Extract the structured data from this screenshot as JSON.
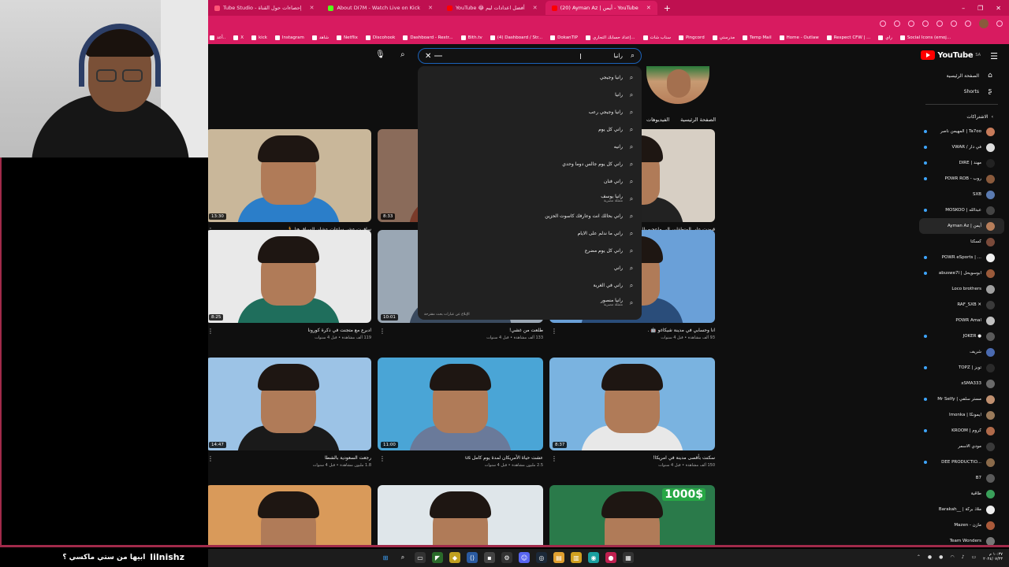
{
  "browser": {
    "tabs": [
      {
        "label": "Tube Studio - إحصاءات حول القناة",
        "color": "#ff5577"
      },
      {
        "label": "About DI7M - Watch Live on Kick",
        "color": "#53fc18"
      },
      {
        "label": "YouTube 😂 أفضل اعدادات ليم",
        "color": "#ff0000"
      },
      {
        "label": "(20) Ayman Az | أيمن - YouTube",
        "color": "#ff0000",
        "active": true
      }
    ],
    "new_tab": "+",
    "window_controls": [
      "–",
      "❐",
      "✕"
    ],
    "bookmarks": [
      "أعد..",
      "X",
      "kick",
      "Instagram",
      "شاهد",
      "Netflix",
      "Discohook",
      "Dashboard - Restr...",
      "Bith.tv",
      "(4) Dashboard / Str...",
      "DokanTIP",
      "إعداد حسابك التجاري...",
      "سناب شات",
      "Pingcord",
      "مدرستي",
      "Temp Mail",
      "Home - Outlaw",
      "Respect CFW | ...",
      "راي",
      "Social Icons (emoj..."
    ]
  },
  "youtube": {
    "logo": "YouTube",
    "logo_region": "SA",
    "search": {
      "query": "رانيا",
      "placeholder": "",
      "clear_label": "✕"
    },
    "suggestions": [
      {
        "text": "رانيا وجيجي"
      },
      {
        "text": "رانيا"
      },
      {
        "text": "رانيا وجيجي رعب"
      },
      {
        "text": "راني كل يوم"
      },
      {
        "text": "رانيه"
      },
      {
        "text": "راني كل يوم جالس دوما وحدي"
      },
      {
        "text": "راني فنان"
      },
      {
        "text": "رانيا يوسف",
        "sub": "ممثلة مصرية"
      },
      {
        "text": "راني بحالك انت وعارفك كاسوت الحزين"
      },
      {
        "text": "راني ما ندلم على الايام"
      },
      {
        "text": "راني كل يوم مضرع"
      },
      {
        "text": "راني"
      },
      {
        "text": "راني في الغربة"
      },
      {
        "text": "رانيا منصور",
        "sub": "ممثلة مصرية"
      }
    ],
    "report_link": "الإبلاغ عن عبارات بحث مقترحة",
    "channel_tabs": [
      "الصفحة الرئيسية",
      "الفيديوهات"
    ],
    "videos": [
      {
        "title": "سافرت عشر ساعات عشان السباق هنا 🏃",
        "stats": "112 ألف مشاهدة • قبل 4 سنوات",
        "duration": "13:30",
        "bg": "#c9b79a",
        "shirt": "#2b7ec9"
      },
      {
        "title": "",
        "stats": "",
        "duration": "8:33",
        "bg": "#8a6b5a",
        "shirt": "#7a3b2a"
      },
      {
        "title": "قبضت على المتطفلين الي ماعجبو بالد...",
        "stats": "239 ألف مشاهدة • قبل 5 سنوات",
        "duration": "",
        "bg": "#d7cfc4",
        "shirt": "#222222"
      },
      {
        "title": "ادبرع مع متجنت في ذكرة كورونا",
        "stats": "119 ألف مشاهدة • قبل 4 سنوات",
        "duration": "8:25",
        "bg": "#e9e9e9",
        "shirt": "#1f6e5c"
      },
      {
        "title": "طلعت من غشي!",
        "stats": "133 ألف مشاهدة • قبل 4 سنوات",
        "duration": "10:01",
        "bg": "#9aa7b4",
        "shirt": "#3a4a5e"
      },
      {
        "title": "انا وحسابي في مدينة شيكاغو 🤖 .",
        "stats": "93 ألف مشاهدة • قبل 4 سنوات",
        "duration": "",
        "bg": "#6aa0d8",
        "shirt": "#2a4d7a"
      },
      {
        "title": "رجعت السعودية بالشطا",
        "stats": "1.8 مليون مشاهدة • قبل 4 سنوات",
        "duration": "14:47",
        "bg": "#9cc3e6",
        "shirt": "#1a1a1a"
      },
      {
        "title": "عشت حياة الأمريكان لمدة يوم كامل us",
        "stats": "2.5 مليون مشاهدة • قبل 4 سنوات",
        "duration": "11:00",
        "bg": "#4aa5d6",
        "shirt": "#6a7a9a"
      },
      {
        "title": "سكنت بأقصى مدينة في امريكا!",
        "stats": "150 ألف مشاهدة • قبل 4 سنوات",
        "duration": "8:37",
        "bg": "#7ab3e0",
        "shirt": "#e8e8e8"
      },
      {
        "title": "",
        "stats": "",
        "duration": "",
        "bg": "#d99a5a",
        "shirt": "#3a3a6a"
      },
      {
        "title": "",
        "stats": "",
        "duration": "",
        "bg": "#dfe6ea",
        "shirt": "#7a7a7a"
      },
      {
        "title": "",
        "stats": "",
        "duration": "",
        "bg": "#2a7a4a",
        "shirt": "#2a2a2a",
        "badge": "1000$"
      }
    ],
    "sidebar": {
      "home": "الصفحة الرئيسية",
      "shorts": "Shorts",
      "subscriptions_heading": "الاشتراكات",
      "subs": [
        {
          "name": "المهيمن ناصر | Ta7oo",
          "color": "#c77b5a",
          "live": true
        },
        {
          "name": "VWAR / في دار",
          "color": "#dddddd",
          "live": true
        },
        {
          "name": "DIRE | مهند",
          "color": "#222222",
          "live": true
        },
        {
          "name": "POWR ROB - روب",
          "color": "#8a5a3c",
          "live": true
        },
        {
          "name": "SXB",
          "color": "#5a7ab0",
          "live": false
        },
        {
          "name": "MOSKOO | عبدالله",
          "color": "#444444",
          "live": true
        },
        {
          "name": "Ayman Az | أيمن",
          "color": "#b77e5a",
          "live": false,
          "active": true
        },
        {
          "name": "كسكتا",
          "color": "#7a4a3a",
          "live": false
        },
        {
          "name": "POWR eSports | ...",
          "color": "#f0f0f0",
          "live": true
        },
        {
          "name": "abuswe7l | ابوسويحل",
          "color": "#9a5a3a",
          "live": true
        },
        {
          "name": "Loco brothers",
          "color": "#a0a0a0",
          "live": false
        },
        {
          "name": "RAF_SXB ✕",
          "color": "#3a3a3a",
          "live": false
        },
        {
          "name": "POWR Amal",
          "color": "#c0c0c0",
          "live": false
        },
        {
          "name": "JOKER ●",
          "color": "#5a5a5a",
          "live": true
        },
        {
          "name": "شريف",
          "color": "#4a6ab0",
          "live": false
        },
        {
          "name": "TOPZ | توبز",
          "color": "#2a2a2a",
          "live": true
        },
        {
          "name": "xSMA333",
          "color": "#6a6a6a",
          "live": false
        },
        {
          "name": "Mr Selfy | مستر سلفي",
          "color": "#c09070",
          "live": true
        },
        {
          "name": "Imonka | ايمونكا",
          "color": "#9a7a5a",
          "live": false
        },
        {
          "name": "KROOM | كروم",
          "color": "#b06a4a",
          "live": true
        },
        {
          "name": "مودي الاسمر",
          "color": "#3a3a3a",
          "live": false
        },
        {
          "name": "DEE PRODUCTIO...",
          "color": "#8a6a4a",
          "live": true
        },
        {
          "name": "B7",
          "color": "#5a5a5a",
          "live": false
        },
        {
          "name": "طاقية",
          "color": "#3aa05a",
          "live": false
        },
        {
          "name": "Barakah__ | ملاذ بركة",
          "color": "#eeeeee",
          "live": false
        },
        {
          "name": "Mazen - مازن",
          "color": "#aa5a3a",
          "live": false
        },
        {
          "name": "Team Wonders",
          "color": "#777777",
          "live": false
        }
      ]
    }
  },
  "overlay": {
    "streamer_name": "lilnishz",
    "caption": "ابيها من ستي ماكسي ؟"
  },
  "taskbar": {
    "clock_time": "١٠:٣٧ م",
    "clock_date": "٢٠٢٤/٠٧/٢٣"
  }
}
